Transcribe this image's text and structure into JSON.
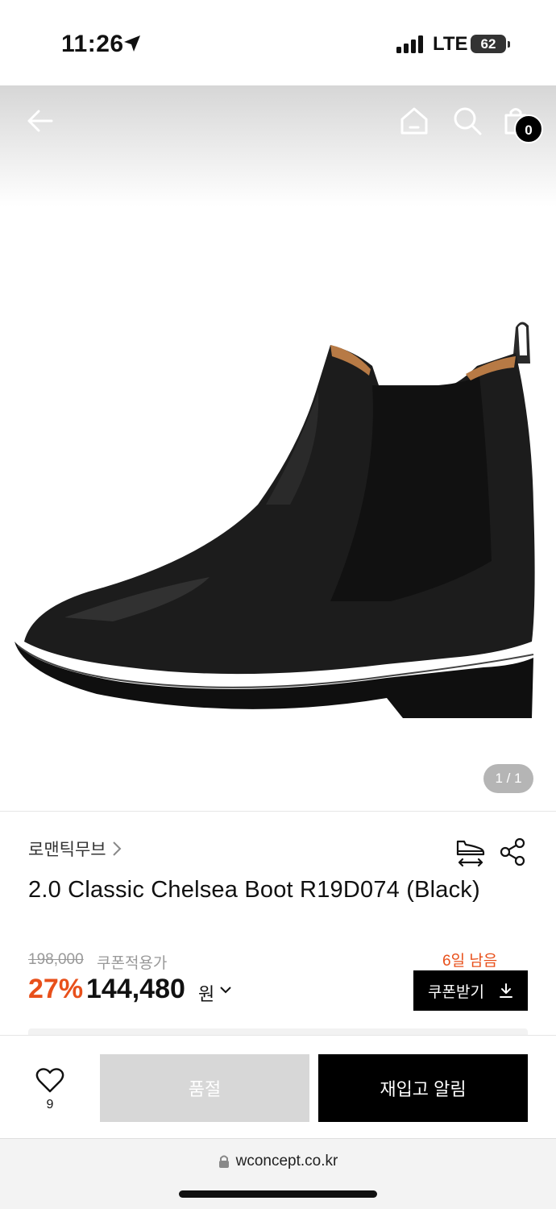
{
  "status": {
    "time": "11:26",
    "network": "LTE",
    "battery": "62"
  },
  "header": {
    "cart_count": "0",
    "icons": [
      "back-arrow-icon",
      "home-icon",
      "search-icon",
      "shopping-bag-icon"
    ]
  },
  "gallery": {
    "page_indicator": "1 / 1"
  },
  "product": {
    "brand": "로맨틱무브",
    "title": "2.0 Classic Chelsea Boot R19D074 (Black)",
    "original_price": "198,000",
    "coupon_label": "쿠폰적용가",
    "discount_rate": "27%",
    "sale_price": "144,480",
    "currency": "원",
    "days_left": "6일 남음",
    "coupon_button": "쿠폰받기"
  },
  "actions": {
    "like_count": "9",
    "soldout_label": "품절",
    "restock_label": "재입고 알림"
  },
  "browser": {
    "url": "wconcept.co.kr"
  },
  "colors": {
    "accent": "#e8501b",
    "primary": "#000000",
    "disabled": "#d7d7d7"
  }
}
